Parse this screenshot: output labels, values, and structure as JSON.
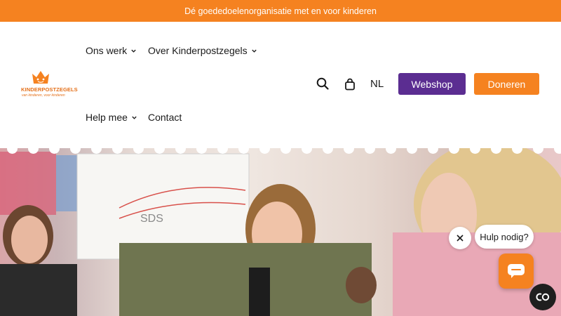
{
  "announcement": {
    "text": "Dé goededoelenorganisatie met en voor kinderen"
  },
  "logo": {
    "brand": "KINDERPOSTZEGELS",
    "tagline": "van kinderen, voor kinderen",
    "icon": "crown-logo-icon"
  },
  "nav": {
    "items": [
      {
        "label": "Ons werk",
        "has_dropdown": true
      },
      {
        "label": "Over Kinderpostzegels",
        "has_dropdown": true
      },
      {
        "label": "Help mee",
        "has_dropdown": true
      },
      {
        "label": "Contact",
        "has_dropdown": false
      }
    ]
  },
  "header_actions": {
    "search_icon": "search-icon",
    "cart_icon": "shopping-bag-icon",
    "language": "NL",
    "webshop_label": "Webshop",
    "donate_label": "Doneren"
  },
  "chat": {
    "prompt": "Hulp nodig?",
    "close_icon": "close-icon",
    "launcher_icon": "chat-icon"
  },
  "accessibility": {
    "icon": "accessibility-icon"
  },
  "colors": {
    "brand_orange": "#f58220",
    "brand_purple": "#5b2d91"
  }
}
